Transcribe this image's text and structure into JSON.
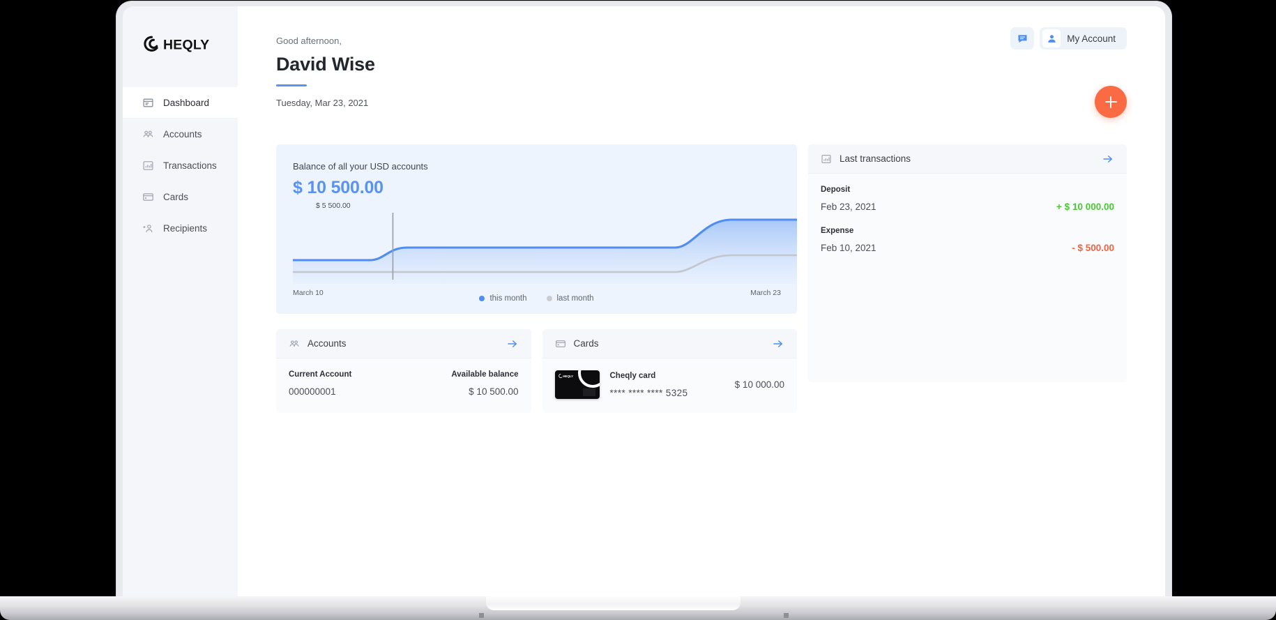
{
  "brand": {
    "name": "CHEQLY"
  },
  "sidebar": {
    "items": [
      {
        "label": "Dashboard",
        "icon": "dashboard-icon",
        "active": true
      },
      {
        "label": "Accounts",
        "icon": "accounts-icon",
        "active": false
      },
      {
        "label": "Transactions",
        "icon": "transactions-icon",
        "active": false
      },
      {
        "label": "Cards",
        "icon": "cards-icon",
        "active": false
      },
      {
        "label": "Recipients",
        "icon": "add-person-icon",
        "active": false
      }
    ]
  },
  "topbar": {
    "chat_icon": "chat-icon",
    "account_icon": "person-icon",
    "account_label": "My Account"
  },
  "header": {
    "greeting": "Good afternoon,",
    "user_name": "David Wise",
    "date": "Tuesday, Mar 23, 2021"
  },
  "fab": {
    "icon": "plus-icon",
    "color": "#fa6a43"
  },
  "balance_card": {
    "label": "Balance of all your USD accounts",
    "value": "$ 10 500.00",
    "value_color": "#5a92f0",
    "marker_label": "$ 5 500.00",
    "axis_left": "March 10",
    "axis_right": "March 23",
    "legend": [
      {
        "label": "this month",
        "color": "#4f8df0"
      },
      {
        "label": "last month",
        "color": "#c9ccd3"
      }
    ]
  },
  "chart_data": {
    "type": "area",
    "title": "Balance of all your USD accounts",
    "xlabel": "",
    "ylabel": "",
    "x": [
      "March 10",
      "March 23"
    ],
    "x_ticks": [
      "March 10",
      "March 23"
    ],
    "annotations": [
      {
        "text": "$ 5 500.00",
        "x_frac": 0.198,
        "series": "this month",
        "value": 5500
      }
    ],
    "grid": false,
    "legend_position": "bottom-center",
    "series": [
      {
        "name": "this month",
        "color": "#4f8df0",
        "filled": true,
        "values": [
          5000,
          5000,
          5000,
          5000,
          5500,
          5500,
          5500,
          5500,
          5500,
          5500,
          5500,
          5500,
          5500,
          7000,
          10500,
          10500,
          10500,
          10500
        ]
      },
      {
        "name": "last month",
        "color": "#c9ccd3",
        "filled": false,
        "values": [
          3000,
          3000,
          3000,
          3000,
          3000,
          3000,
          3000,
          3000,
          3000,
          3000,
          3000,
          3000,
          3000,
          3600,
          4800,
          4800,
          4800,
          4800
        ]
      }
    ],
    "ylim": [
      0,
      12000
    ]
  },
  "transactions_panel": {
    "title": "Last transactions",
    "icon": "chart-bars-icon",
    "arrow": "arrow-right-icon",
    "items": [
      {
        "type": "Deposit",
        "date": "Feb 23, 2021",
        "amount": "+ $ 10 000.00",
        "color": "#4bc836"
      },
      {
        "type": "Expense",
        "date": "Feb 10, 2021",
        "amount": "- $ 500.00",
        "color": "#f4623f"
      }
    ]
  },
  "accounts_panel": {
    "title": "Accounts",
    "icon": "accounts-icon",
    "arrow": "arrow-right-icon",
    "name_label": "Current Account",
    "balance_label": "Available balance",
    "account_number": "000000001",
    "balance": "$ 10 500.00"
  },
  "cards_panel": {
    "title": "Cards",
    "icon": "cards-icon",
    "arrow": "arrow-right-icon",
    "card_name": "Cheqly card",
    "card_number": "**** **** **** 5325",
    "card_amount": "$ 10 000.00",
    "card_brand": "CHEQLY"
  }
}
